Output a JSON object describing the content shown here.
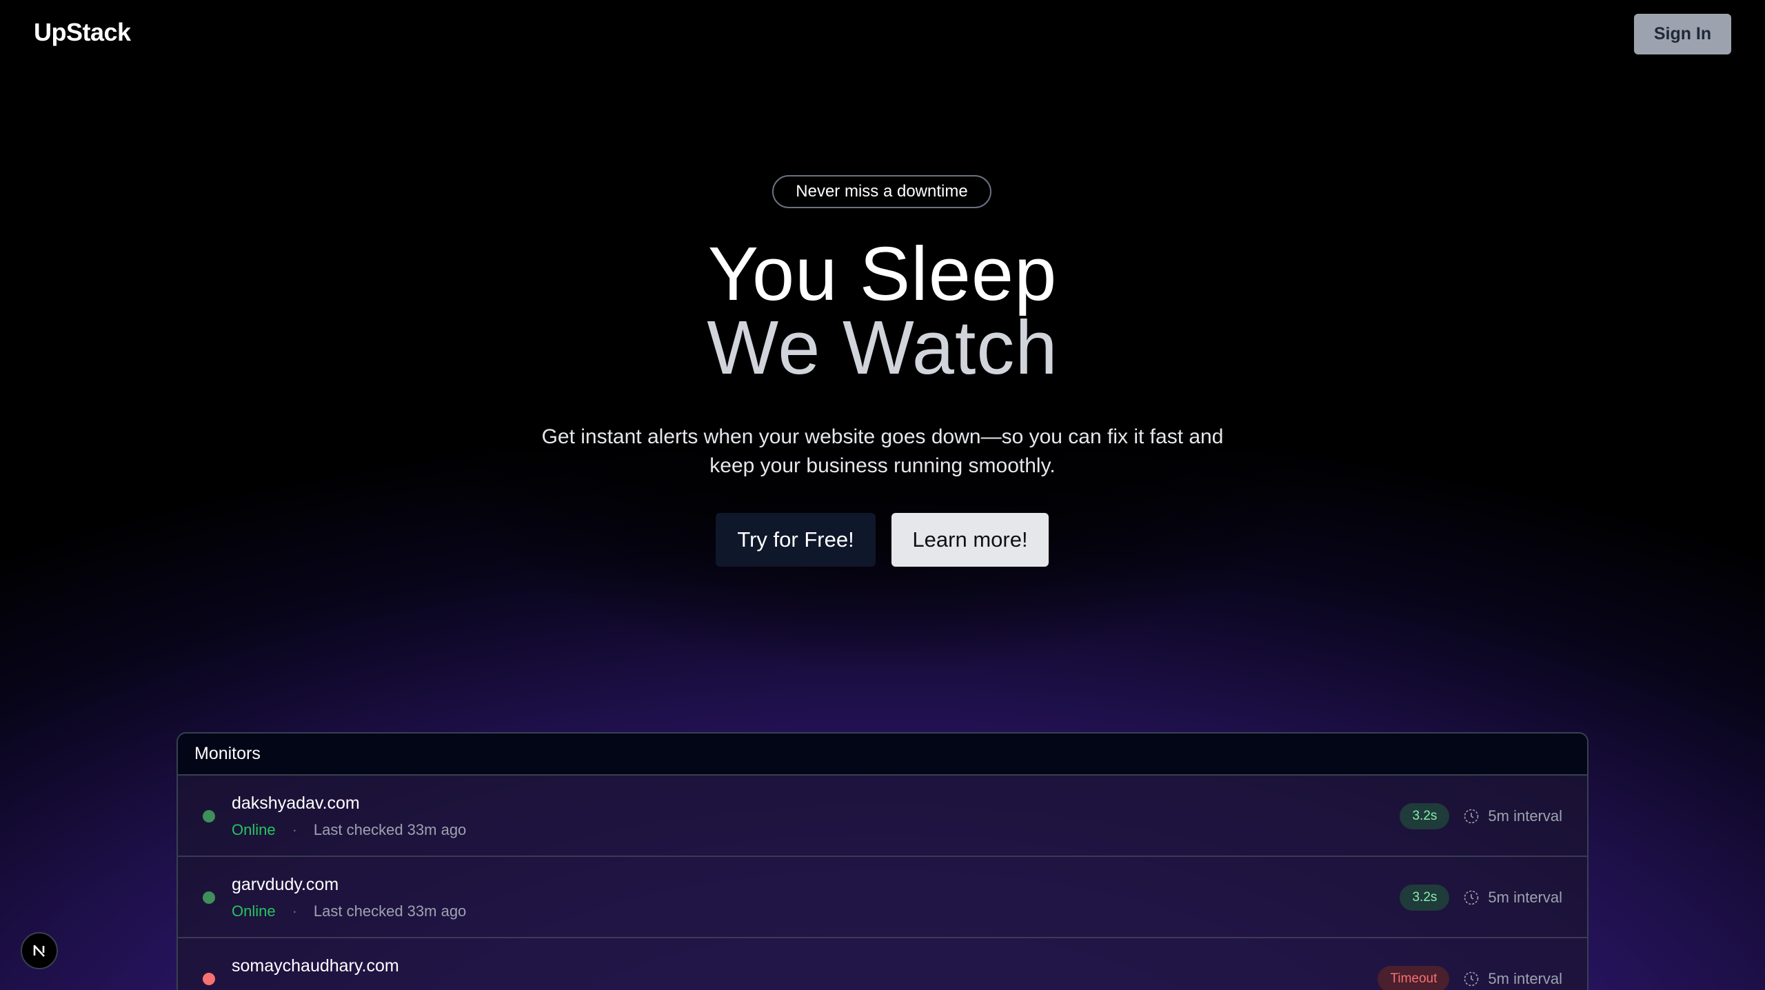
{
  "header": {
    "logo": "UpStack",
    "signin_label": "Sign In"
  },
  "hero": {
    "tagline": "Never miss a downtime",
    "title_line1": "You Sleep",
    "title_line2": "We Watch",
    "subtitle": "Get instant alerts when your website goes down—so you can fix it fast and keep your business running smoothly.",
    "primary_cta": "Try for Free!",
    "secondary_cta": "Learn more!"
  },
  "monitors": {
    "title": "Monitors",
    "items": [
      {
        "name": "dakshyadav.com",
        "status": "Online",
        "last_checked": "Last checked 33m ago",
        "badge": "3.2s",
        "interval": "5m interval",
        "status_color": "#3f8f5a"
      },
      {
        "name": "garvdudy.com",
        "status": "Online",
        "last_checked": "Last checked 33m ago",
        "badge": "3.2s",
        "interval": "5m interval",
        "status_color": "#3f8f5a"
      },
      {
        "name": "somaychaudhary.com",
        "status": "",
        "last_checked": "",
        "badge": "Timeout",
        "interval": "5m interval",
        "status_color": "#f87171"
      }
    ]
  },
  "colors": {
    "accent_online": "#22c55e",
    "accent_error": "#f87171",
    "glow": "#3e1f94"
  },
  "icons": {
    "interval": "clock-dashed-icon",
    "framework_badge": "next-logo-icon"
  }
}
